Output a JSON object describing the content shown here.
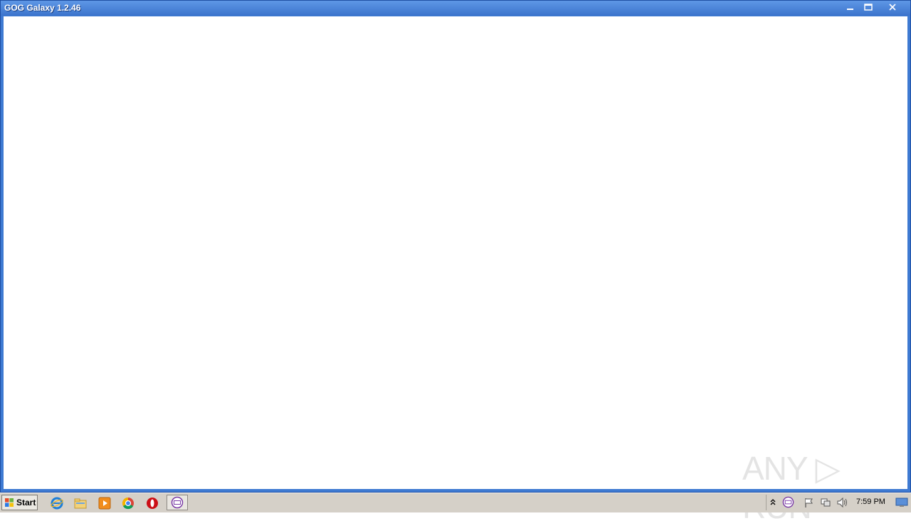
{
  "window": {
    "title": "GOG Galaxy 1.2.46",
    "minimize_glyph": "–",
    "maximize_glyph": "▢",
    "close_glyph": "✕"
  },
  "watermark": {
    "text": "ANY ▷ RUN"
  },
  "taskbar": {
    "start_label": "Start",
    "pinned": [
      "internet-explorer-icon",
      "file-explorer-icon",
      "media-player-icon",
      "chrome-icon",
      "opera-icon",
      "gog-galaxy-icon"
    ],
    "tray": {
      "icons": [
        "show-hidden-icons-icon",
        "gog-galaxy-tray-icon",
        "action-center-flag-icon",
        "network-icon",
        "volume-icon"
      ],
      "clock": "7:59 PM"
    }
  }
}
